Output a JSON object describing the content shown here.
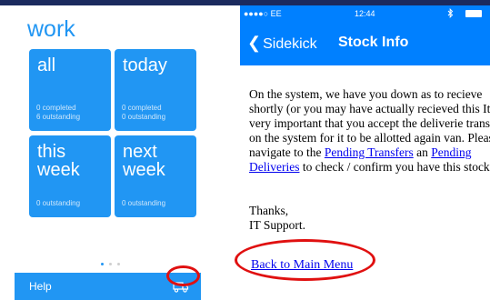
{
  "left": {
    "title": "work",
    "tiles": [
      {
        "label": "all",
        "stat1": "0 completed",
        "stat2": "6 outstanding"
      },
      {
        "label": "today",
        "stat1": "0 completed",
        "stat2": "0 outstanding"
      },
      {
        "label1": "this",
        "label2": "week",
        "stat1": "0 outstanding"
      },
      {
        "label1": "next",
        "label2": "week",
        "stat1": "0 outstanding"
      }
    ],
    "help_label": "Help",
    "truck_icon": "truck-icon"
  },
  "right": {
    "status": {
      "carrier": "●●●●○ EE",
      "time": "12:44"
    },
    "nav": {
      "back_label": "Sidekick",
      "title": "Stock Info"
    },
    "message_part1": "On the system, we have you down as to recieve shortly (or you may have actually recieved this It is very important that you accept the deliverie transfers on the system for it to be allotted again van. Please navigate to the ",
    "link_pending_transfers": "Pending Transfers",
    "message_part2": " an ",
    "link_pending_deliveries": "Pending Deliveries",
    "message_part3": " to check / confirm you have this stock.",
    "thanks": "Thanks,",
    "signature": "IT Support.",
    "back_link": "Back to Main Menu"
  },
  "colors": {
    "brand_blue": "#2196f3",
    "ios_blue": "#0080ff",
    "highlight_red": "#e01010",
    "top_navy": "#1b2a5e"
  }
}
